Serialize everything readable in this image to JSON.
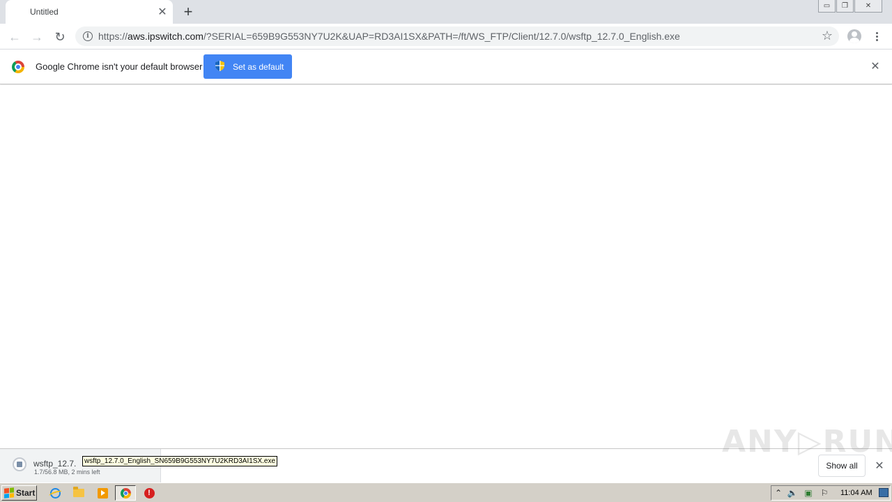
{
  "tab": {
    "title": "Untitled",
    "close_glyph": "✕",
    "new_tab_glyph": "+"
  },
  "window_controls": {
    "minimize": "▭",
    "restore": "❐",
    "close": "✕"
  },
  "toolbar": {
    "back_glyph": "←",
    "forward_glyph": "→",
    "reload_glyph": "↻",
    "url_prefix": "https://",
    "url_host": "aws.ipswitch.com",
    "url_path": "/?SERIAL=659B9G553NY7U2K&UAP=RD3AI1SX&PATH=/ft/WS_FTP/Client/12.7.0/wsftp_12.7.0_English.exe",
    "info_glyph": "i",
    "star_glyph": "☆"
  },
  "infobar": {
    "message": "Google Chrome isn't your default browser",
    "button_label": "Set as default",
    "close_glyph": "✕"
  },
  "download_shelf": {
    "file_name": "wsftp_12.7.",
    "status": "1.7/56.8 MB, 2 mins left",
    "tooltip": "wsftp_12.7.0_English_SN659B9G553NY7U2KRD3AI1SX.exe",
    "show_all_label": "Show all",
    "close_glyph": "✕",
    "watermark": "ANY▷RUN"
  },
  "taskbar": {
    "start_label": "Start",
    "clock": "11:04 AM",
    "tray_glyphs": {
      "expand": "⌃",
      "volume": "🔈",
      "network": "▣",
      "flag": "⚐"
    },
    "stop_glyph": "!"
  },
  "colors": {
    "accent": "#4285f4",
    "tab_strip": "#dee1e6",
    "omnibox": "#f1f3f4",
    "taskbar": "#d4d0c8"
  },
  "icons": [
    "chrome-logo-icon",
    "info-icon",
    "star-icon",
    "avatar-icon",
    "menu-icon",
    "shield-icon",
    "file-icon",
    "ie-icon",
    "folder-icon",
    "media-player-icon",
    "chrome-icon",
    "stop-icon",
    "windows-flag-icon"
  ]
}
